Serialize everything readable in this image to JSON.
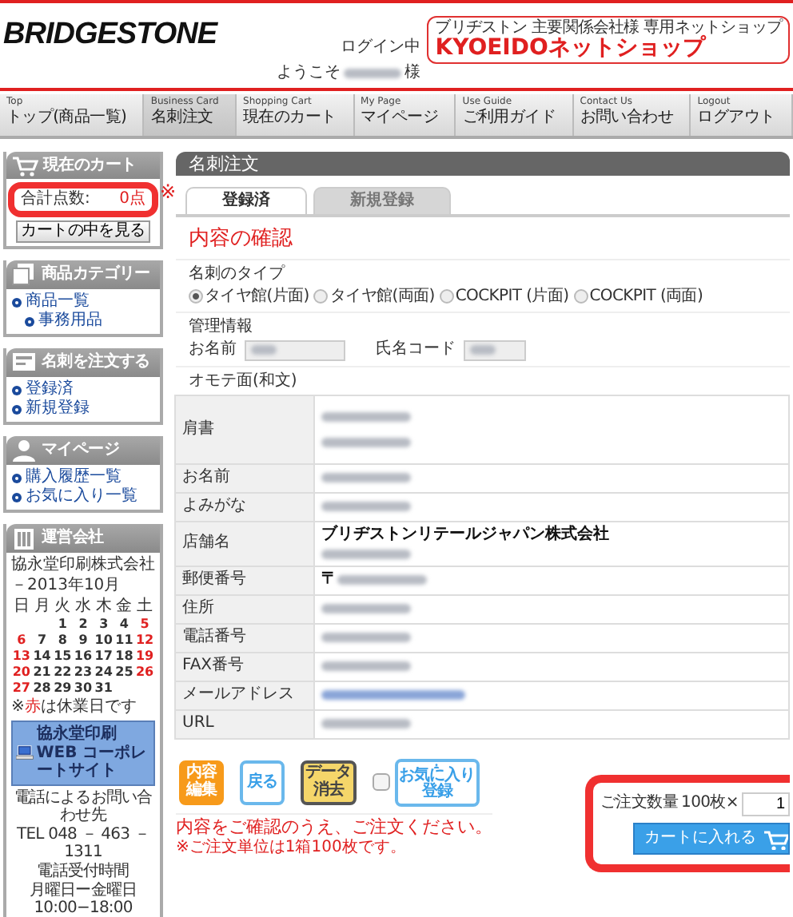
{
  "header": {
    "logo": "BRIDGESTONE",
    "login_status": "ログイン中",
    "welcome": "ようこそ",
    "welcome_suffix": "様",
    "banner": {
      "subtitle": "ブリヂストン 主要関係会社様 専用ネットショップ",
      "title": "KYOEIDOネットショップ"
    }
  },
  "nav": [
    {
      "en": "Top",
      "label": "トップ(商品一覧)",
      "selected": false
    },
    {
      "en": "Business Card",
      "label": "名刺注文",
      "selected": true
    },
    {
      "en": "Shopping Cart",
      "label": "現在のカート",
      "selected": false
    },
    {
      "en": "My Page",
      "label": "マイページ",
      "selected": false
    },
    {
      "en": "Use Guide",
      "label": "ご利用ガイド",
      "selected": false
    },
    {
      "en": "Contact Us",
      "label": "お問い合わせ",
      "selected": false
    },
    {
      "en": "Logout",
      "label": "ログアウト",
      "selected": false
    }
  ],
  "sidebar": {
    "cart": {
      "title": "現在のカート",
      "total_label": "合計点数:",
      "total_value": "0点",
      "button": "カートの中を見る",
      "highlighted": true
    },
    "menus": [
      {
        "kind": "category",
        "title": "商品カテゴリー",
        "items": [
          {
            "label": "商品一覧",
            "children": [
              {
                "label": "事務用品"
              }
            ]
          }
        ]
      },
      {
        "kind": "card",
        "title": "名刺を注文する",
        "items": [
          {
            "label": "登録済"
          },
          {
            "label": "新規登録"
          }
        ]
      },
      {
        "kind": "person",
        "title": "マイページ",
        "items": [
          {
            "label": "購入履歴一覧"
          },
          {
            "label": "お気に入り一覧"
          }
        ]
      }
    ],
    "company": {
      "title": "運営会社",
      "name": "協永堂印刷株式会社",
      "month": "－2013年10月",
      "weekdays": [
        "日",
        "月",
        "火",
        "水",
        "木",
        "金",
        "土"
      ],
      "weeks": [
        [
          {
            "kind": "blank"
          },
          {
            "kind": "blank"
          },
          {
            "kind": "day",
            "d": "1",
            "holiday": false
          },
          {
            "kind": "day",
            "d": "2",
            "holiday": false
          },
          {
            "kind": "day",
            "d": "3",
            "holiday": false
          },
          {
            "kind": "day",
            "d": "4",
            "holiday": false
          },
          {
            "kind": "day",
            "d": "5",
            "holiday": true
          }
        ],
        [
          {
            "kind": "day",
            "d": "6",
            "holiday": true
          },
          {
            "kind": "day",
            "d": "7",
            "holiday": false
          },
          {
            "kind": "day",
            "d": "8",
            "holiday": false
          },
          {
            "kind": "day",
            "d": "9",
            "holiday": false
          },
          {
            "kind": "day",
            "d": "10",
            "holiday": false
          },
          {
            "kind": "day",
            "d": "11",
            "holiday": false
          },
          {
            "kind": "day",
            "d": "12",
            "holiday": true
          }
        ],
        [
          {
            "kind": "day",
            "d": "13",
            "holiday": true
          },
          {
            "kind": "day",
            "d": "14",
            "holiday": false
          },
          {
            "kind": "day",
            "d": "15",
            "holiday": false
          },
          {
            "kind": "day",
            "d": "16",
            "holiday": false
          },
          {
            "kind": "day",
            "d": "17",
            "holiday": false
          },
          {
            "kind": "day",
            "d": "18",
            "holiday": false
          },
          {
            "kind": "day",
            "d": "19",
            "holiday": true
          }
        ],
        [
          {
            "kind": "day",
            "d": "20",
            "holiday": true
          },
          {
            "kind": "day",
            "d": "21",
            "holiday": false
          },
          {
            "kind": "day",
            "d": "22",
            "holiday": false
          },
          {
            "kind": "day",
            "d": "23",
            "holiday": false
          },
          {
            "kind": "day",
            "d": "24",
            "holiday": false
          },
          {
            "kind": "day",
            "d": "25",
            "holiday": false
          },
          {
            "kind": "day",
            "d": "26",
            "holiday": true
          }
        ],
        [
          {
            "kind": "day",
            "d": "27",
            "holiday": true
          },
          {
            "kind": "day",
            "d": "28",
            "holiday": false
          },
          {
            "kind": "day",
            "d": "29",
            "holiday": false
          },
          {
            "kind": "day",
            "d": "30",
            "holiday": false
          },
          {
            "kind": "day",
            "d": "31",
            "holiday": false
          }
        ]
      ],
      "legend": [
        {
          "text": "※",
          "red": false
        },
        {
          "text": "赤",
          "red": true
        },
        {
          "text": "は休業日です",
          "red": false
        }
      ],
      "site_banner": "協永堂印刷 WEB コーポレートサイト",
      "contact": [
        "電話によるお問い合わせ先",
        "TEL 048 － 463 － 1311",
        "電話受付時間",
        "月曜日ー金曜日10:00−18:00"
      ]
    }
  },
  "main": {
    "title": "名刺注文",
    "note_mark": "※",
    "tabs": [
      {
        "label": "登録済",
        "selected": true
      },
      {
        "label": "新規登録",
        "selected": false
      }
    ],
    "heading": "内容の確認",
    "card_type": {
      "label": "名刺のタイプ",
      "options": [
        {
          "label": "タイヤ館(片面)",
          "selected": true
        },
        {
          "label": "タイヤ館(両面)",
          "selected": false
        },
        {
          "label": "COCKPIT (片面)",
          "selected": false
        },
        {
          "label": "COCKPIT (両面)",
          "selected": false
        }
      ]
    },
    "management": {
      "label": "管理情報",
      "fields": [
        {
          "label": "お名前",
          "blurred": true
        },
        {
          "label": "氏名コード",
          "blurred": true
        }
      ]
    },
    "front": {
      "label": "オモテ面(和文)",
      "rows": [
        {
          "label": "肩書",
          "lines": [
            {
              "kind": "blurred"
            },
            {
              "kind": "blurred"
            }
          ],
          "tall": true
        },
        {
          "label": "お名前",
          "lines": [
            {
              "kind": "blurred"
            }
          ],
          "tall": false
        },
        {
          "label": "よみがな",
          "lines": [
            {
              "kind": "blurred"
            }
          ],
          "tall": false
        },
        {
          "label": "店舗名",
          "lines": [
            {
              "kind": "text",
              "text": "ブリヂストンリテールジャパン株式会社"
            },
            {
              "kind": "blurred"
            }
          ],
          "tall": false
        },
        {
          "label": "郵便番号",
          "lines": [
            {
              "kind": "prefixed",
              "text": "〒"
            }
          ],
          "tall": false
        },
        {
          "label": "住所",
          "lines": [
            {
              "kind": "blurred"
            }
          ],
          "tall": false
        },
        {
          "label": "電話番号",
          "lines": [
            {
              "kind": "blurred"
            }
          ],
          "tall": false
        },
        {
          "label": "FAX番号",
          "lines": [
            {
              "kind": "blurred"
            }
          ],
          "tall": false
        },
        {
          "label": "メールアドレス",
          "lines": [
            {
              "kind": "blurred-link"
            }
          ],
          "tall": false
        },
        {
          "label": "URL",
          "lines": [
            {
              "kind": "blurred"
            }
          ],
          "tall": false
        }
      ]
    },
    "actions": [
      {
        "kind": "edit",
        "lines": [
          "内容",
          "編集"
        ]
      },
      {
        "kind": "back",
        "lines": [
          "戻る"
        ]
      },
      {
        "kind": "clear",
        "lines": [
          "データ",
          "消去"
        ]
      },
      {
        "kind": "checkbox",
        "checked": false
      },
      {
        "kind": "favorite",
        "lines": [
          "お気に入り",
          "登録"
        ]
      }
    ],
    "message": "内容をご確認のうえ、ご注文ください。",
    "note": "※ご注文単位は1箱100枚です。",
    "order": {
      "quantity_label": "ご注文数量",
      "unit": "100枚×",
      "quantity": "1",
      "button": "カートに入れる",
      "highlighted": true
    }
  }
}
